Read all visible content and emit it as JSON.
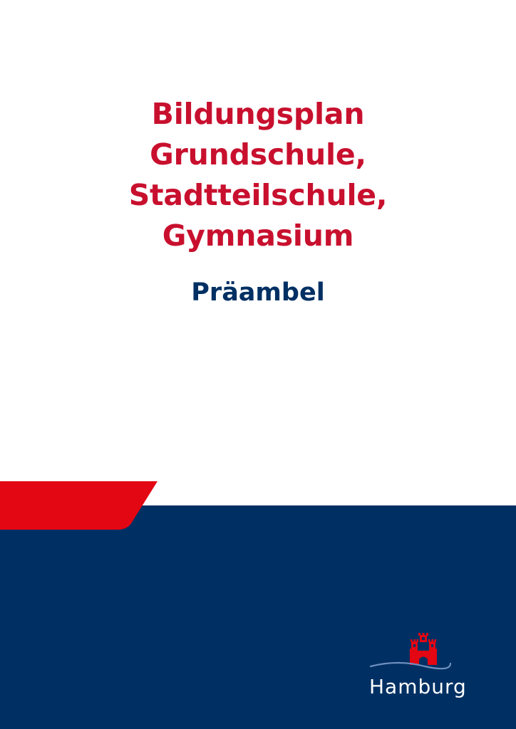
{
  "document": {
    "title_lines": [
      "Bildungsplan",
      "Grundschule,",
      "Stadtteilschule,",
      "Gymnasium"
    ],
    "subtitle": "Präambel"
  },
  "logo": {
    "text": "Hamburg",
    "icon": "hamburg-castle-icon"
  },
  "colors": {
    "red": "#c8102e",
    "accent_red": "#e30613",
    "navy": "#003063",
    "white": "#ffffff",
    "wave": "#6f8fbf"
  }
}
